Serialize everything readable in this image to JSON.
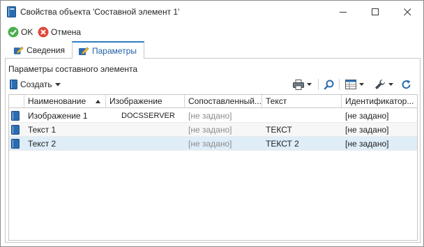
{
  "window": {
    "title": "Свойства объекта 'Составной элемент 1'",
    "icon": "book-icon"
  },
  "actions": {
    "ok_label": "OK",
    "cancel_label": "Отмена"
  },
  "tabs": [
    {
      "label": "Сведения",
      "active": false
    },
    {
      "label": "Параметры",
      "active": true
    }
  ],
  "panel": {
    "title": "Параметры составного элемента",
    "create_label": "Создать"
  },
  "grid": {
    "columns": [
      "Наименование",
      "Изображение",
      "Сопоставленный...",
      "Текст",
      "Идентификатор..."
    ],
    "rows": [
      {
        "name": "Изображение 1",
        "image": "DOCSSERVER",
        "mapped": "[не задано]",
        "text": "",
        "identifier": "[не задано]"
      },
      {
        "name": "Текст 1",
        "image": "",
        "mapped": "[не задано]",
        "text": "ТЕКСТ",
        "identifier": "[не задано]"
      },
      {
        "name": "Текст 2",
        "image": "",
        "mapped": "[не задано]",
        "text": "ТЕКСТ 2",
        "identifier": "[не задано]"
      }
    ],
    "selected_row": 2
  },
  "colors": {
    "accent": "#2e7dc4",
    "ok_green": "#4caf50",
    "cancel_red": "#e0483b",
    "selection": "#deedf8"
  }
}
